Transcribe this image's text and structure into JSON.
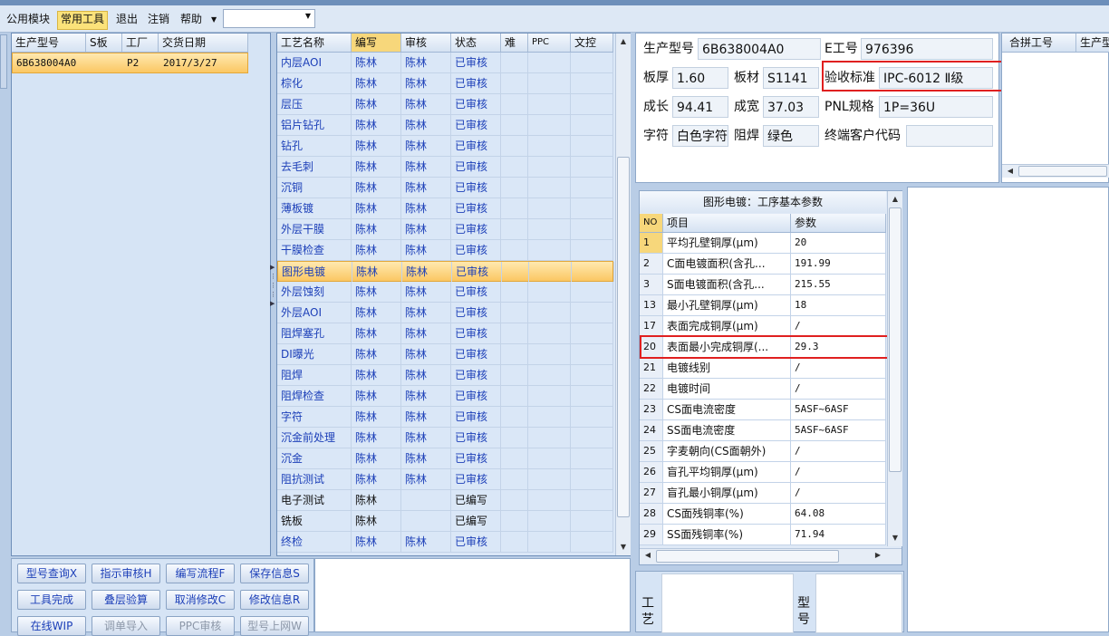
{
  "menu": {
    "items": [
      "公用模块",
      "常用工具",
      "退出",
      "注销",
      "帮助"
    ],
    "active_index": 1
  },
  "orders": {
    "columns": [
      "生产型号",
      "S板",
      "工厂",
      "交货日期"
    ],
    "rows": [
      {
        "model": "6B638004A0",
        "s_board": "",
        "factory": "P2",
        "delivery_date": "2017/3/27"
      }
    ]
  },
  "process": {
    "columns": [
      "工艺名称",
      "编写",
      "审核",
      "状态",
      "难",
      "PPC",
      "文控"
    ],
    "selected_index": 10,
    "rows": [
      {
        "name": "内层AOI",
        "writer": "陈林",
        "reviewer": "陈林",
        "status": "已审核"
      },
      {
        "name": "棕化",
        "writer": "陈林",
        "reviewer": "陈林",
        "status": "已审核"
      },
      {
        "name": "层压",
        "writer": "陈林",
        "reviewer": "陈林",
        "status": "已审核"
      },
      {
        "name": "铝片钻孔",
        "writer": "陈林",
        "reviewer": "陈林",
        "status": "已审核"
      },
      {
        "name": "钻孔",
        "writer": "陈林",
        "reviewer": "陈林",
        "status": "已审核"
      },
      {
        "name": "去毛刺",
        "writer": "陈林",
        "reviewer": "陈林",
        "status": "已审核"
      },
      {
        "name": "沉铜",
        "writer": "陈林",
        "reviewer": "陈林",
        "status": "已审核"
      },
      {
        "name": "薄板镀",
        "writer": "陈林",
        "reviewer": "陈林",
        "status": "已审核"
      },
      {
        "name": "外层干膜",
        "writer": "陈林",
        "reviewer": "陈林",
        "status": "已审核"
      },
      {
        "name": "干膜检查",
        "writer": "陈林",
        "reviewer": "陈林",
        "status": "已审核"
      },
      {
        "name": "图形电镀",
        "writer": "陈林",
        "reviewer": "陈林",
        "status": "已审核"
      },
      {
        "name": "外层蚀刻",
        "writer": "陈林",
        "reviewer": "陈林",
        "status": "已审核"
      },
      {
        "name": "外层AOI",
        "writer": "陈林",
        "reviewer": "陈林",
        "status": "已审核"
      },
      {
        "name": "阻焊塞孔",
        "writer": "陈林",
        "reviewer": "陈林",
        "status": "已审核"
      },
      {
        "name": "DI曝光",
        "writer": "陈林",
        "reviewer": "陈林",
        "status": "已审核"
      },
      {
        "name": "阻焊",
        "writer": "陈林",
        "reviewer": "陈林",
        "status": "已审核"
      },
      {
        "name": "阻焊检查",
        "writer": "陈林",
        "reviewer": "陈林",
        "status": "已审核"
      },
      {
        "name": "字符",
        "writer": "陈林",
        "reviewer": "陈林",
        "status": "已审核"
      },
      {
        "name": "沉金前处理",
        "writer": "陈林",
        "reviewer": "陈林",
        "status": "已审核"
      },
      {
        "name": "沉金",
        "writer": "陈林",
        "reviewer": "陈林",
        "status": "已审核"
      },
      {
        "name": "阻抗测试",
        "writer": "陈林",
        "reviewer": "陈林",
        "status": "已审核"
      },
      {
        "name": "电子测试",
        "writer": "陈林",
        "reviewer": "",
        "status": "已编写"
      },
      {
        "name": "铣板",
        "writer": "陈林",
        "reviewer": "",
        "status": "已编写"
      },
      {
        "name": "终检",
        "writer": "陈林",
        "reviewer": "陈林",
        "status": "已审核"
      }
    ]
  },
  "buttons": {
    "rows": [
      [
        "型号查询X",
        "指示审核H",
        "编写流程F",
        "保存信息S"
      ],
      [
        "工具完成",
        "叠层验算",
        "取消修改C",
        "修改信息R"
      ],
      [
        "在线WIP",
        "调单导入",
        "PPC审核",
        "型号上网W"
      ]
    ],
    "disabled": [
      "调单导入",
      "PPC审核",
      "型号上网W"
    ]
  },
  "info": {
    "model_label": "生产型号",
    "model_value": "6B638004A0",
    "e_label": "E工号",
    "e_value": "976396",
    "thickness_label": "板厚",
    "thickness_value": "1.60",
    "material_label": "板材",
    "material_value": "S1141",
    "standard_label": "验收标准",
    "standard_value": "IPC-6012 Ⅱ级",
    "length_label": "成长",
    "length_value": "94.41",
    "width_label": "成宽",
    "width_value": "37.03",
    "pnl_label": "PNL规格",
    "pnl_value": "1P=36U",
    "char_label": "字符",
    "char_value": "白色字符",
    "mask_label": "阻焊",
    "mask_value": "绿色",
    "customer_label": "终端客户代码",
    "customer_value": ""
  },
  "merge": {
    "columns": [
      "合拼工号",
      "生产型"
    ]
  },
  "params": {
    "title": "图形电镀：工序基本参数",
    "columns": [
      "NO",
      "项目",
      "参数"
    ],
    "rows": [
      {
        "no": "1",
        "item": "平均孔壁铜厚(μm)",
        "value": "20"
      },
      {
        "no": "2",
        "item": "C面电镀面积(含孔...",
        "value": "191.99"
      },
      {
        "no": "3",
        "item": "S面电镀面积(含孔...",
        "value": "215.55"
      },
      {
        "no": "13",
        "item": "最小孔壁铜厚(μm)",
        "value": "18"
      },
      {
        "no": "17",
        "item": "表面完成铜厚(μm)",
        "value": "/"
      },
      {
        "no": "20",
        "item": "表面最小完成铜厚(...",
        "value": "29.3"
      },
      {
        "no": "21",
        "item": "电镀线别",
        "value": "/"
      },
      {
        "no": "22",
        "item": "电镀时间",
        "value": "/"
      },
      {
        "no": "23",
        "item": "CS面电流密度",
        "value": "5ASF~6ASF"
      },
      {
        "no": "24",
        "item": "SS面电流密度",
        "value": "5ASF~6ASF"
      },
      {
        "no": "25",
        "item": "字麦朝向(CS面朝外)",
        "value": "/"
      },
      {
        "no": "26",
        "item": "盲孔平均铜厚(μm)",
        "value": "/"
      },
      {
        "no": "27",
        "item": "盲孔最小铜厚(μm)",
        "value": "/"
      },
      {
        "no": "28",
        "item": "CS面残铜率(%)",
        "value": "64.08"
      },
      {
        "no": "29",
        "item": "SS面残铜率(%)",
        "value": "71.94"
      }
    ]
  },
  "bottom_tabs": {
    "process_label": "工艺",
    "model_label": "型号"
  },
  "colors": {
    "selection": "#fbc763",
    "highlight_box": "#e02020",
    "link_text": "#1c3fb8",
    "panel_bg": "#d6e4f5"
  }
}
